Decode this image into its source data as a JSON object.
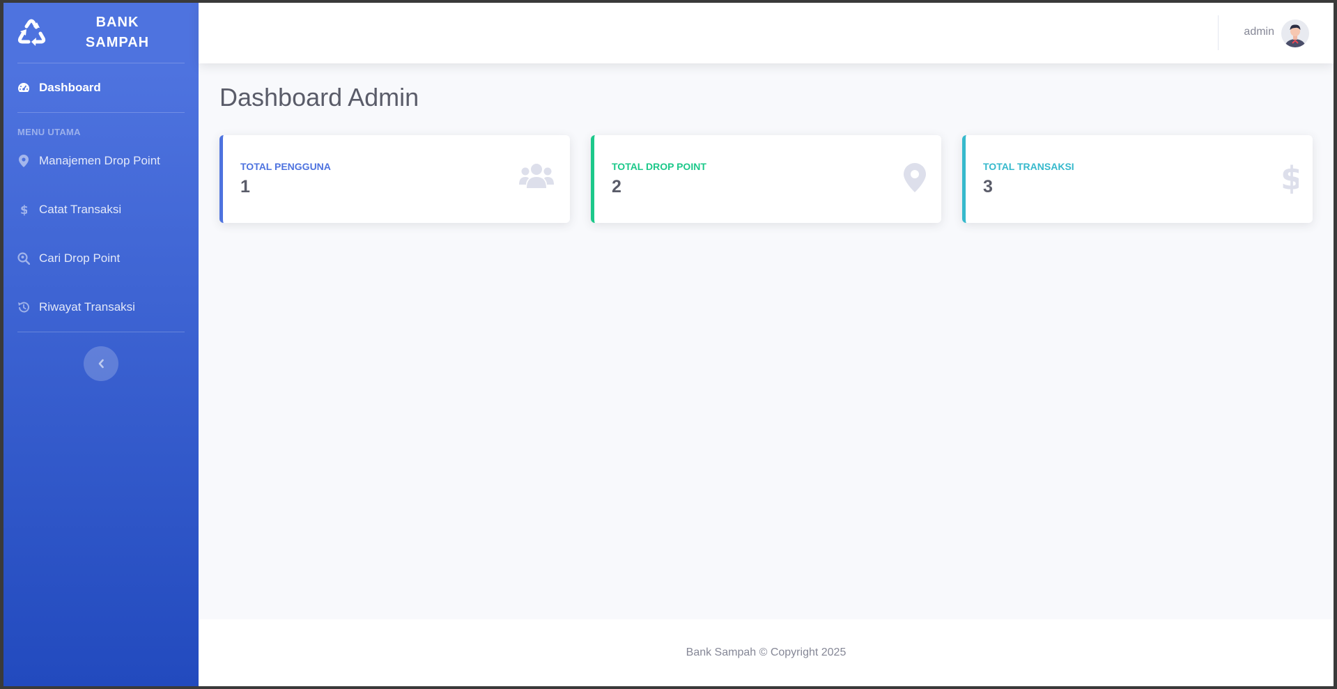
{
  "brand": {
    "name": "BANK SAMPAH",
    "icon": "recycle-icon"
  },
  "sidebar": {
    "dashboard": {
      "label": "Dashboard",
      "icon": "tachometer-icon"
    },
    "section_heading": "MENU UTAMA",
    "items": [
      {
        "label": "Manajemen Drop Point",
        "icon": "map-marker-icon"
      },
      {
        "label": "Catat Transaksi",
        "icon": "dollar-icon"
      },
      {
        "label": "Cari Drop Point",
        "icon": "search-location-icon"
      },
      {
        "label": "Riwayat Transaksi",
        "icon": "history-icon"
      }
    ],
    "toggle_icon": "chevron-left-icon"
  },
  "topbar": {
    "user_name": "admin",
    "avatar": "user-avatar"
  },
  "page": {
    "title": "Dashboard Admin"
  },
  "cards": [
    {
      "label": "TOTAL PENGGUNA",
      "value": "1",
      "color": "#4e73df",
      "icon": "users-icon"
    },
    {
      "label": "TOTAL DROP POINT",
      "value": "2",
      "color": "#1cc88a",
      "icon": "map-marker-icon"
    },
    {
      "label": "TOTAL TRANSAKSI",
      "value": "3",
      "color": "#36b9cc",
      "icon": "dollar-icon"
    }
  ],
  "footer": {
    "text": "Bank Sampah © Copyright 2025"
  },
  "colors": {
    "primary": "#4e73df",
    "success": "#1cc88a",
    "info": "#36b9cc",
    "text": "#5a5c69",
    "muted": "#858796"
  }
}
